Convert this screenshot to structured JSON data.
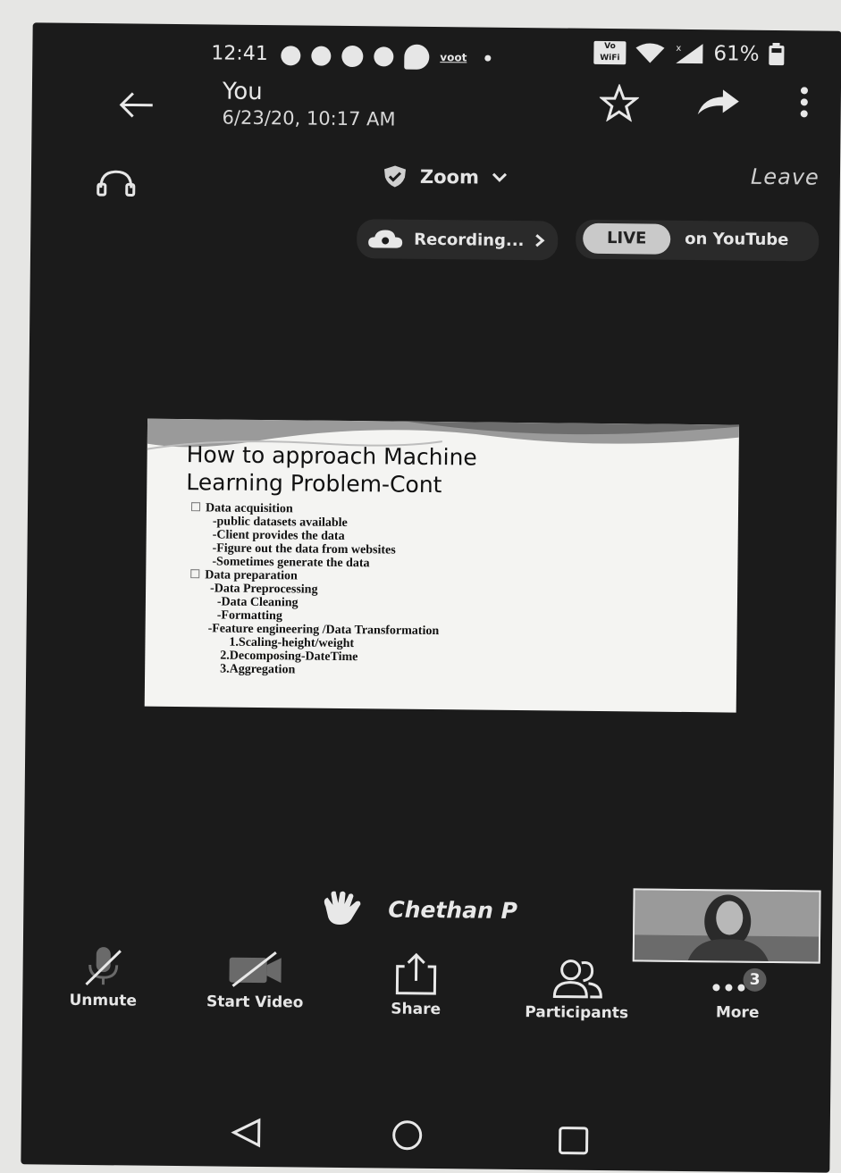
{
  "status_bar": {
    "time": "12:41",
    "carrier_label": "voot",
    "wifi_badge": "Vo WiFi",
    "battery": "61%"
  },
  "header": {
    "title": "You",
    "subtitle": "6/23/20, 10:17 AM"
  },
  "meeting": {
    "app_name": "Zoom",
    "leave_label": "Leave",
    "recording_label": "Recording...",
    "live_label": "LIVE",
    "live_destination": "on YouTube",
    "speaker_name": "Chethan P"
  },
  "slide": {
    "title_line1": "How to approach Machine",
    "title_line2": "Learning Problem-Cont",
    "lines": [
      "Data acquisition",
      "-public datasets available",
      "-Client provides the data",
      "-Figure out the data from websites",
      "-Sometimes generate the data",
      "Data preparation",
      "-Data Preprocessing",
      "-Data Cleaning",
      "-Formatting",
      "-Feature engineering /Data Transformation",
      "1.Scaling-height/weight",
      "2.Decomposing-DateTime",
      "3.Aggregation"
    ]
  },
  "controls": {
    "unmute": "Unmute",
    "start_video": "Start Video",
    "share": "Share",
    "participants": "Participants",
    "more": "More",
    "more_badge": "3"
  }
}
